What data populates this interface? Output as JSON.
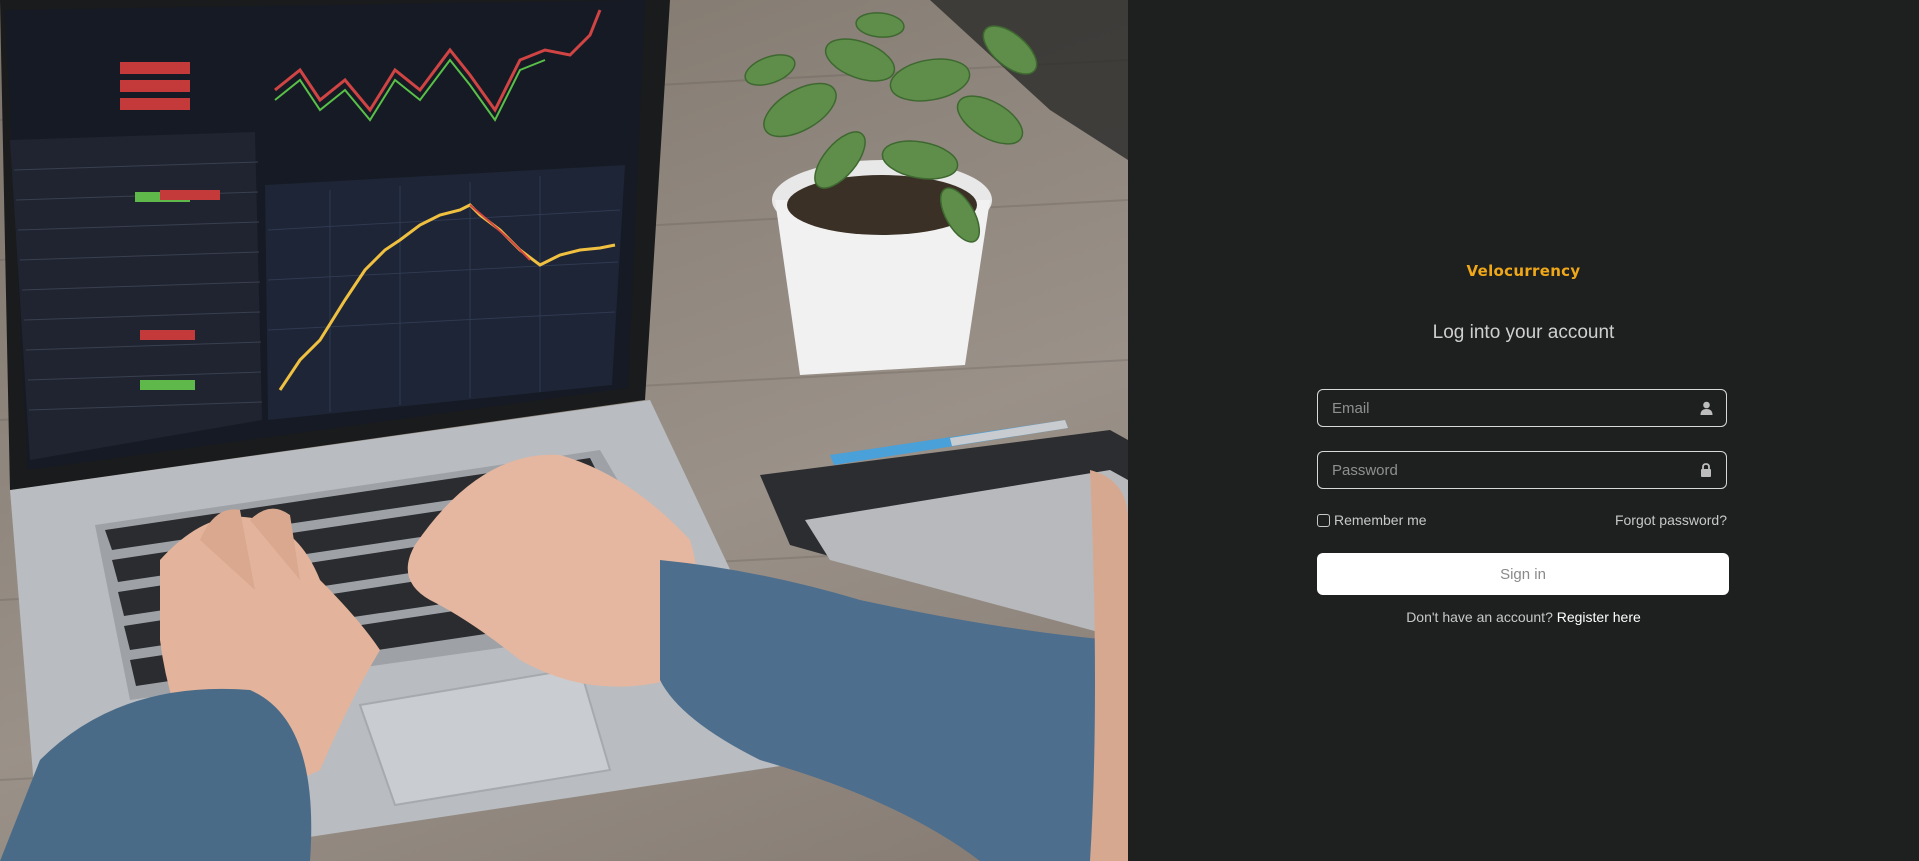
{
  "brand": {
    "name": "Velocurrency",
    "accent_color": "#f0a818"
  },
  "login": {
    "heading": "Log into your account",
    "email": {
      "placeholder": "Email",
      "value": "",
      "icon": "user-icon"
    },
    "password": {
      "placeholder": "Password",
      "value": "",
      "icon": "lock-icon"
    },
    "remember_label": "Remember me",
    "remember_checked": false,
    "forgot_label": "Forgot password?",
    "signin_label": "Sign in",
    "register_prompt": "Don't have an account?",
    "register_link": "Register here"
  },
  "hero": {
    "image": "laptop-trading-chart-photo"
  },
  "colors": {
    "panel_bg": "#1e2020",
    "text": "#cfcfcf",
    "button_bg": "#ffffff"
  }
}
